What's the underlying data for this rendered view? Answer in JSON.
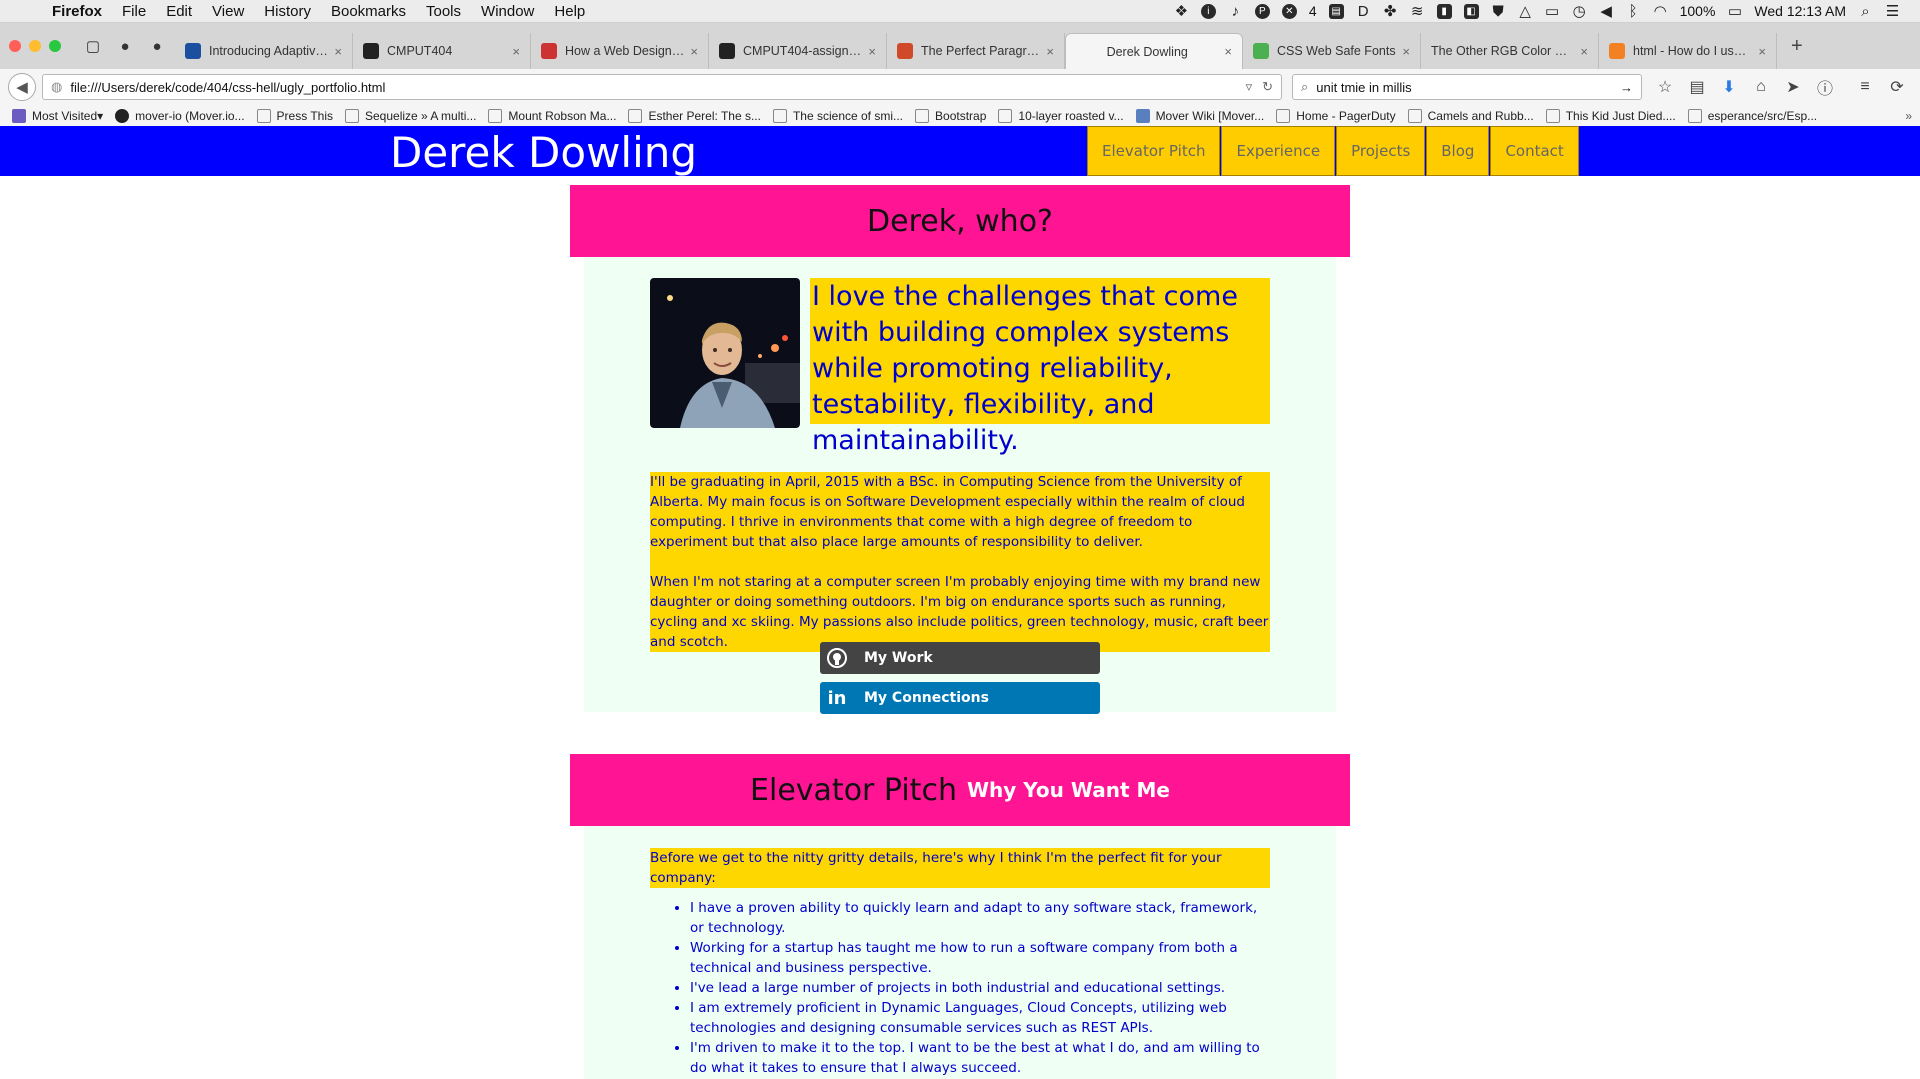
{
  "menubar": {
    "app": "Firefox",
    "menus": [
      "File",
      "Edit",
      "View",
      "History",
      "Bookmarks",
      "Tools",
      "Window",
      "Help"
    ],
    "badge_count": "4",
    "battery": "100%",
    "clock": "Wed 12:13 AM"
  },
  "tabs": [
    {
      "title": "Introducing Adaptive P...",
      "icon": "paypal-icon",
      "color": "#1b4fa0"
    },
    {
      "title": "CMPUT404",
      "icon": "github-icon",
      "color": "#222222"
    },
    {
      "title": "How a Web Design Go...",
      "icon": "site-icon",
      "color": "#cc3333"
    },
    {
      "title": "CMPUT404-assignme...",
      "icon": "github-icon",
      "color": "#222222"
    },
    {
      "title": "The Perfect Paragraph ...",
      "icon": "site-icon",
      "color": "#d04a2a"
    },
    {
      "title": "Derek Dowling",
      "icon": "",
      "color": "#f5f5f5",
      "active": true
    },
    {
      "title": "CSS Web Safe Fonts",
      "icon": "site-icon",
      "color": "#4caf50"
    },
    {
      "title": "The Other RGB Color Chart",
      "icon": "",
      "color": "#d6d6d6"
    },
    {
      "title": "html - How do I use a ...",
      "icon": "site-icon",
      "color": "#f48024"
    }
  ],
  "nav": {
    "url": "file:///Users/derek/code/404/css-hell/ugly_portfolio.html",
    "search": "unit tmie in millis"
  },
  "bookmarks": [
    {
      "label": "Most Visited",
      "kind": "fx"
    },
    {
      "label": "mover-io (Mover.io...",
      "kind": "gh"
    },
    {
      "label": "Press This",
      "kind": "page"
    },
    {
      "label": "Sequelize » A multi...",
      "kind": "page"
    },
    {
      "label": "Mount Robson Ma...",
      "kind": "page"
    },
    {
      "label": "Esther Perel: The s...",
      "kind": "page"
    },
    {
      "label": "The science of smi...",
      "kind": "page"
    },
    {
      "label": "Bootstrap",
      "kind": "page"
    },
    {
      "label": "10-layer roasted v...",
      "kind": "page"
    },
    {
      "label": "Mover Wiki [Mover...",
      "kind": "mv"
    },
    {
      "label": "Home - PagerDuty",
      "kind": "page"
    },
    {
      "label": "Camels and Rubb...",
      "kind": "page"
    },
    {
      "label": "This Kid Just Died....",
      "kind": "page"
    },
    {
      "label": "esperance/src/Esp...",
      "kind": "page"
    }
  ],
  "site": {
    "name": "Derek Dowling",
    "nav": [
      "Elevator Pitch",
      "Experience",
      "Projects",
      "Blog",
      "Contact"
    ]
  },
  "about": {
    "title": "Derek, who?",
    "tagline": "I love the challenges that come with building complex systems while promoting reliability, testability, flexibility, and maintainability.",
    "bio1": "I'll be graduating in April, 2015 with a BSc. in Computing Science from the University of Alberta. My main focus is on Software Development especially within the realm of cloud computing. I thrive in environments that come with a high degree of freedom to experiment but that also place large amounts of responsibility to deliver.",
    "bio2": "When I'm not staring at a computer screen I'm probably enjoying time with my brand new daughter or doing something outdoors. I'm big on endurance sports such as running, cycling and xc skiing. My passions also include politics, green technology, music, craft beer and scotch.",
    "github_label": "My Work",
    "linkedin_label": "My Connections"
  },
  "pitch": {
    "title": "Elevator Pitch",
    "subtitle": "Why You Want Me",
    "intro": "Before we get to the nitty gritty details, here's why I think I'm the perfect fit for your company:",
    "items": [
      "I have a proven ability to quickly learn and adapt to any software stack, framework, or technology.",
      "Working for a startup has taught me how to run a software company from both a technical and business perspective.",
      "I've lead a large number of projects in both industrial and educational settings.",
      "I am extremely proficient in Dynamic Languages, Cloud Concepts, utilizing web technologies and designing consumable services such as REST APIs.",
      "I'm driven to make it to the top. I want to be the best at what I do, and am willing to do what it takes to ensure that I always succeed."
    ]
  },
  "colors": {
    "header_blue": "#0000ff",
    "nav_yellow": "#ffcc00",
    "section_pink": "#ff1493",
    "highlight_gold": "#ffd700",
    "text_blue": "#0000cc",
    "mint_panel": "#f0fff3",
    "github_dark": "#444444",
    "linkedin_blue": "#0077b5"
  }
}
